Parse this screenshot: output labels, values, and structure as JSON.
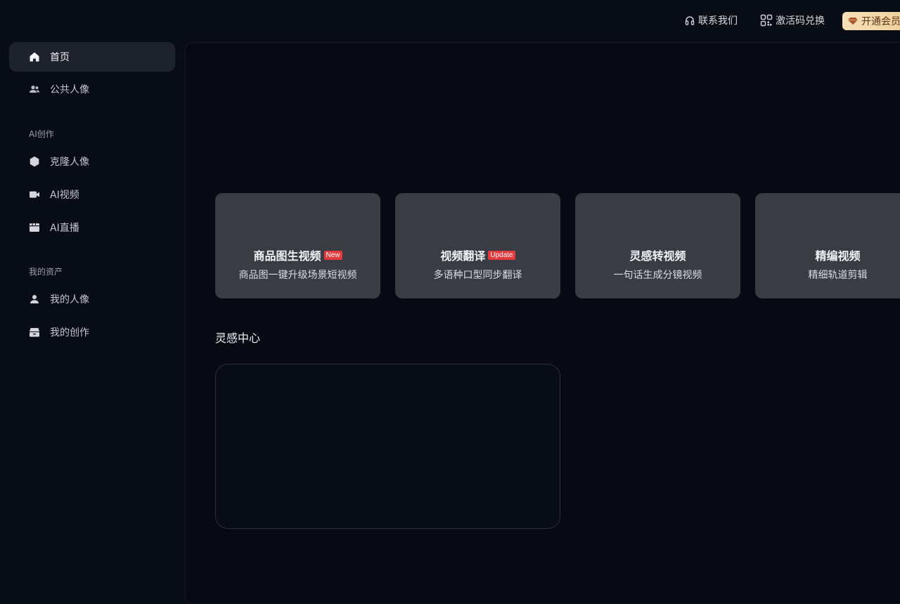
{
  "topbar": {
    "contact_label": "联系我们",
    "redeem_label": "激活码兑换",
    "vip_label": "开通会员"
  },
  "sidebar": {
    "items": [
      {
        "label": "首页",
        "icon": "home-icon"
      },
      {
        "label": "公共人像",
        "icon": "users-icon"
      }
    ],
    "sections": [
      {
        "title": "AI创作",
        "items": [
          {
            "label": "克隆人像",
            "icon": "hexagon-icon"
          },
          {
            "label": "AI视频",
            "icon": "video-icon"
          },
          {
            "label": "AI直播",
            "icon": "live-icon"
          }
        ]
      },
      {
        "title": "我的资产",
        "items": [
          {
            "label": "我的人像",
            "icon": "user-icon"
          },
          {
            "label": "我的创作",
            "icon": "archive-icon"
          }
        ]
      }
    ]
  },
  "cards": [
    {
      "title": "商品图生视频",
      "badge": "New",
      "subtitle": "商品图一键升级场景短视频"
    },
    {
      "title": "视频翻译",
      "badge": "Update",
      "subtitle": "多语种口型同步翻译"
    },
    {
      "title": "灵感转视频",
      "badge": "",
      "subtitle": "一句话生成分镜视频"
    },
    {
      "title": "精编视频",
      "badge": "",
      "subtitle": "精细轨道剪辑"
    }
  ],
  "inspiration": {
    "title": "灵感中心"
  },
  "colors": {
    "background": "#080c15",
    "card": "#3a3c44",
    "badge": "#e5393e",
    "vip_gradient_start": "#f6dfb6",
    "vip_gradient_end": "#efcf9a"
  }
}
